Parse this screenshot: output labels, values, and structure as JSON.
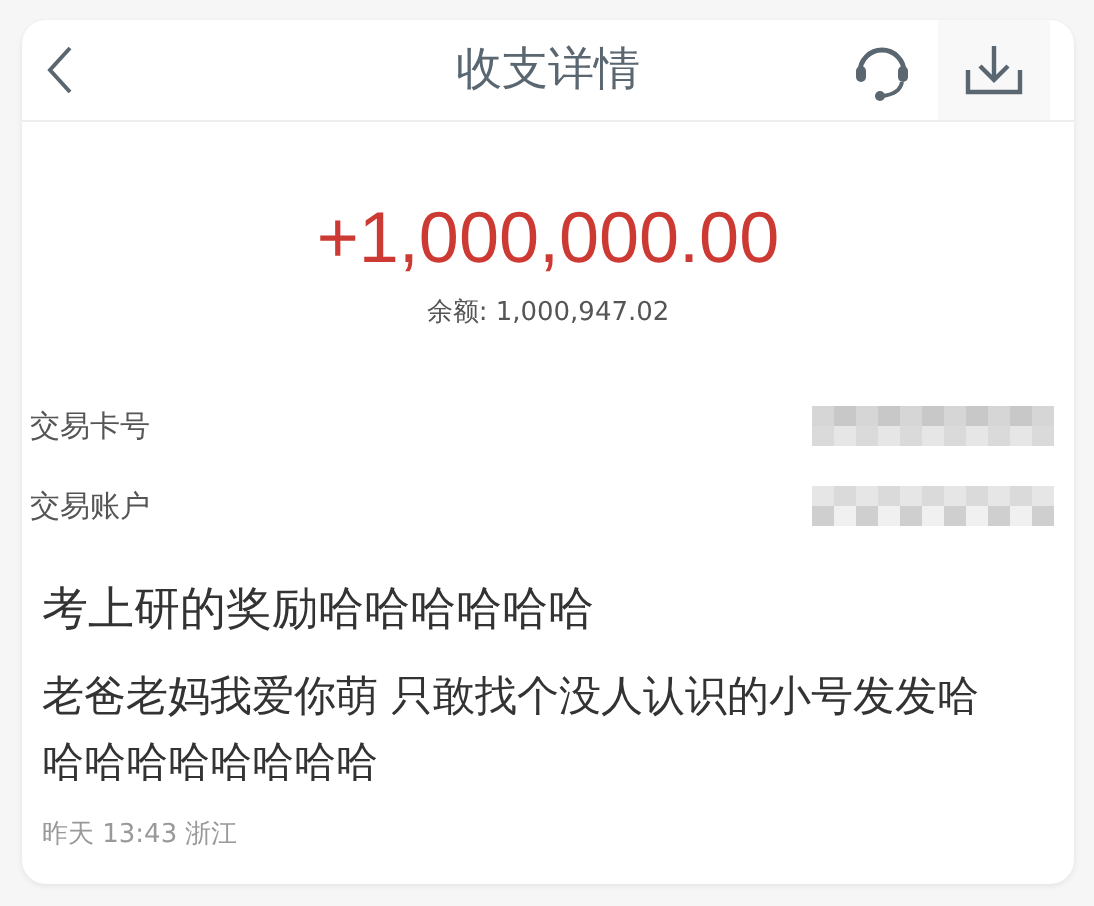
{
  "header": {
    "title": "收支详情"
  },
  "amount": "+1,000,000.00",
  "balance": "余额: 1,000,947.02",
  "details": [
    {
      "label": "交易卡号",
      "redacted": true
    },
    {
      "label": "交易账户",
      "redacted": true
    }
  ],
  "post": {
    "title": "考上研的奖励哈哈哈哈哈哈",
    "body": "老爸老妈我爱你萌 只敢找个没人认识的小号发发哈哈哈哈哈哈哈哈哈",
    "meta": "昨天 13:43 浙江"
  }
}
